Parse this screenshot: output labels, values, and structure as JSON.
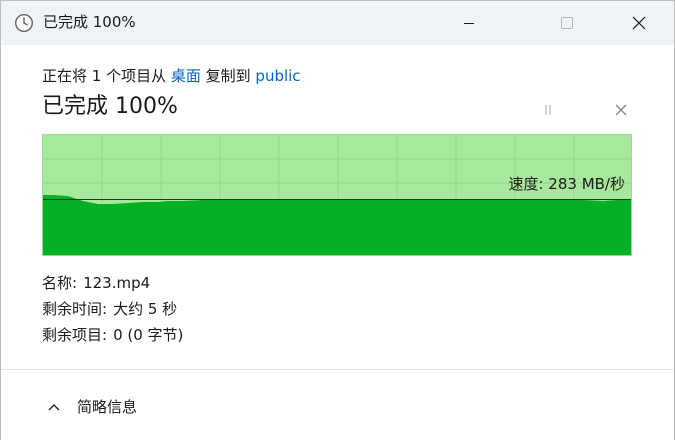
{
  "window": {
    "title": "已完成 100%"
  },
  "header": {
    "copy_prefix": "正在将 1 个项目从 ",
    "source": "桌面",
    "copy_middle": " 复制到 ",
    "destination": "public",
    "status": "已完成 100%"
  },
  "graph": {
    "speed_label": "速度: 283 MB/秒",
    "progress_fraction": 1.0
  },
  "details": {
    "name_label": "名称:",
    "name_value": "123.mp4",
    "time_label": "剩余时间:",
    "time_value": "大约 5 秒",
    "items_label": "剩余项目:",
    "items_value": "0 (0 字节)"
  },
  "footer": {
    "toggle_label": "简略信息"
  },
  "icons": {
    "window": "clock-icon",
    "minimize": "minimize-icon",
    "maximize": "maximize-icon",
    "close": "close-icon",
    "pause": "pause-icon",
    "cancel": "cancel-icon",
    "toggle": "chevron-up-icon"
  },
  "colors": {
    "accent_link": "#0067c0",
    "graph_area": "#06b025",
    "graph_background": "#a8e89c",
    "titlebar": "#eef3f8"
  }
}
